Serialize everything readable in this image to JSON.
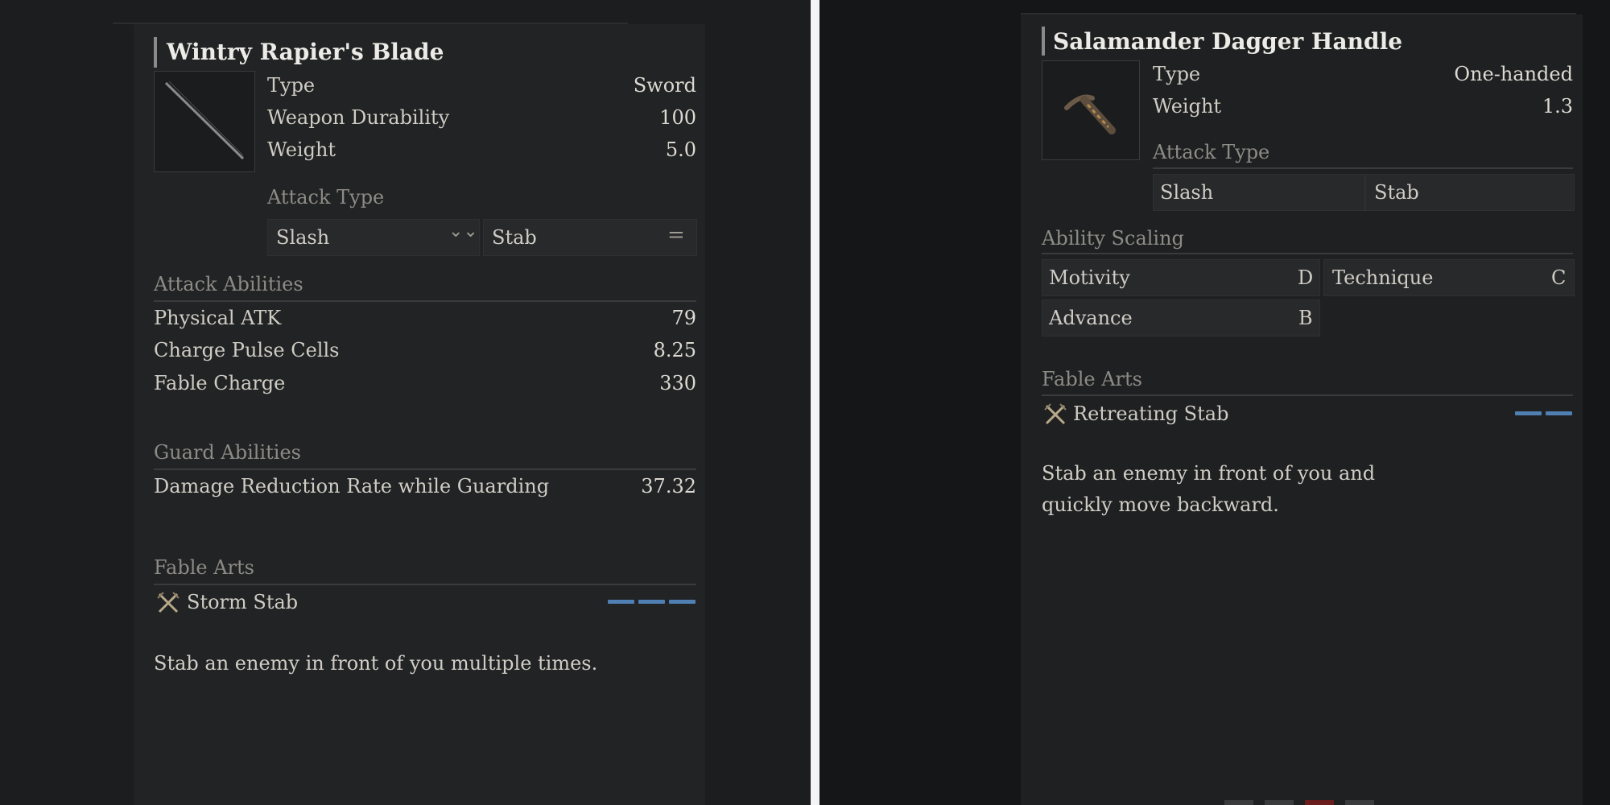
{
  "left": {
    "title": "Wintry Rapier's Blade",
    "image_icon": "rapier-blade-icon",
    "stats": [
      {
        "label": "Type",
        "value": "Sword"
      },
      {
        "label": "Weapon Durability",
        "value": "100"
      },
      {
        "label": "Weight",
        "value": "5.0"
      }
    ],
    "attack_type": {
      "heading": "Attack Type",
      "slash": {
        "label": "Slash",
        "icon": "chevron-double-down-icon",
        "glyph": "⌄⌄"
      },
      "stab": {
        "label": "Stab",
        "icon": "equals-icon",
        "glyph": "="
      }
    },
    "attack_abilities": {
      "heading": "Attack Abilities",
      "rows": [
        {
          "label": "Physical ATK",
          "value": "79"
        },
        {
          "label": "Charge Pulse Cells",
          "value": "8.25"
        },
        {
          "label": "Fable Charge",
          "value": "330"
        }
      ]
    },
    "guard_abilities": {
      "heading": "Guard Abilities",
      "rows": [
        {
          "label": "Damage Reduction Rate while Guarding",
          "value": "37.32"
        }
      ]
    },
    "fable_arts": {
      "heading": "Fable Arts",
      "name": "Storm Stab",
      "icon": "crossed-swords-icon",
      "slots": 3,
      "description": "Stab an enemy in front of you multiple times."
    }
  },
  "right": {
    "title": "Salamander Dagger Handle",
    "image_icon": "dagger-handle-icon",
    "stats": [
      {
        "label": "Type",
        "value": "One-handed"
      },
      {
        "label": "Weight",
        "value": "1.3"
      }
    ],
    "attack_type": {
      "heading": "Attack Type",
      "slash": "Slash",
      "stab": "Stab"
    },
    "ability_scaling": {
      "heading": "Ability Scaling",
      "motivity": {
        "label": "Motivity",
        "grade": "D"
      },
      "technique": {
        "label": "Technique",
        "grade": "C"
      },
      "advance": {
        "label": "Advance",
        "grade": "B"
      }
    },
    "fable_arts": {
      "heading": "Fable Arts",
      "name": "Retreating Stab",
      "icon": "crossed-swords-icon",
      "slots": 2,
      "description": "Stab an enemy in front of you and quickly move backward."
    }
  },
  "colors": {
    "background": "#1c1d1f",
    "fable_slot": "#4f7fb3",
    "divider": "#f4f4f4"
  }
}
